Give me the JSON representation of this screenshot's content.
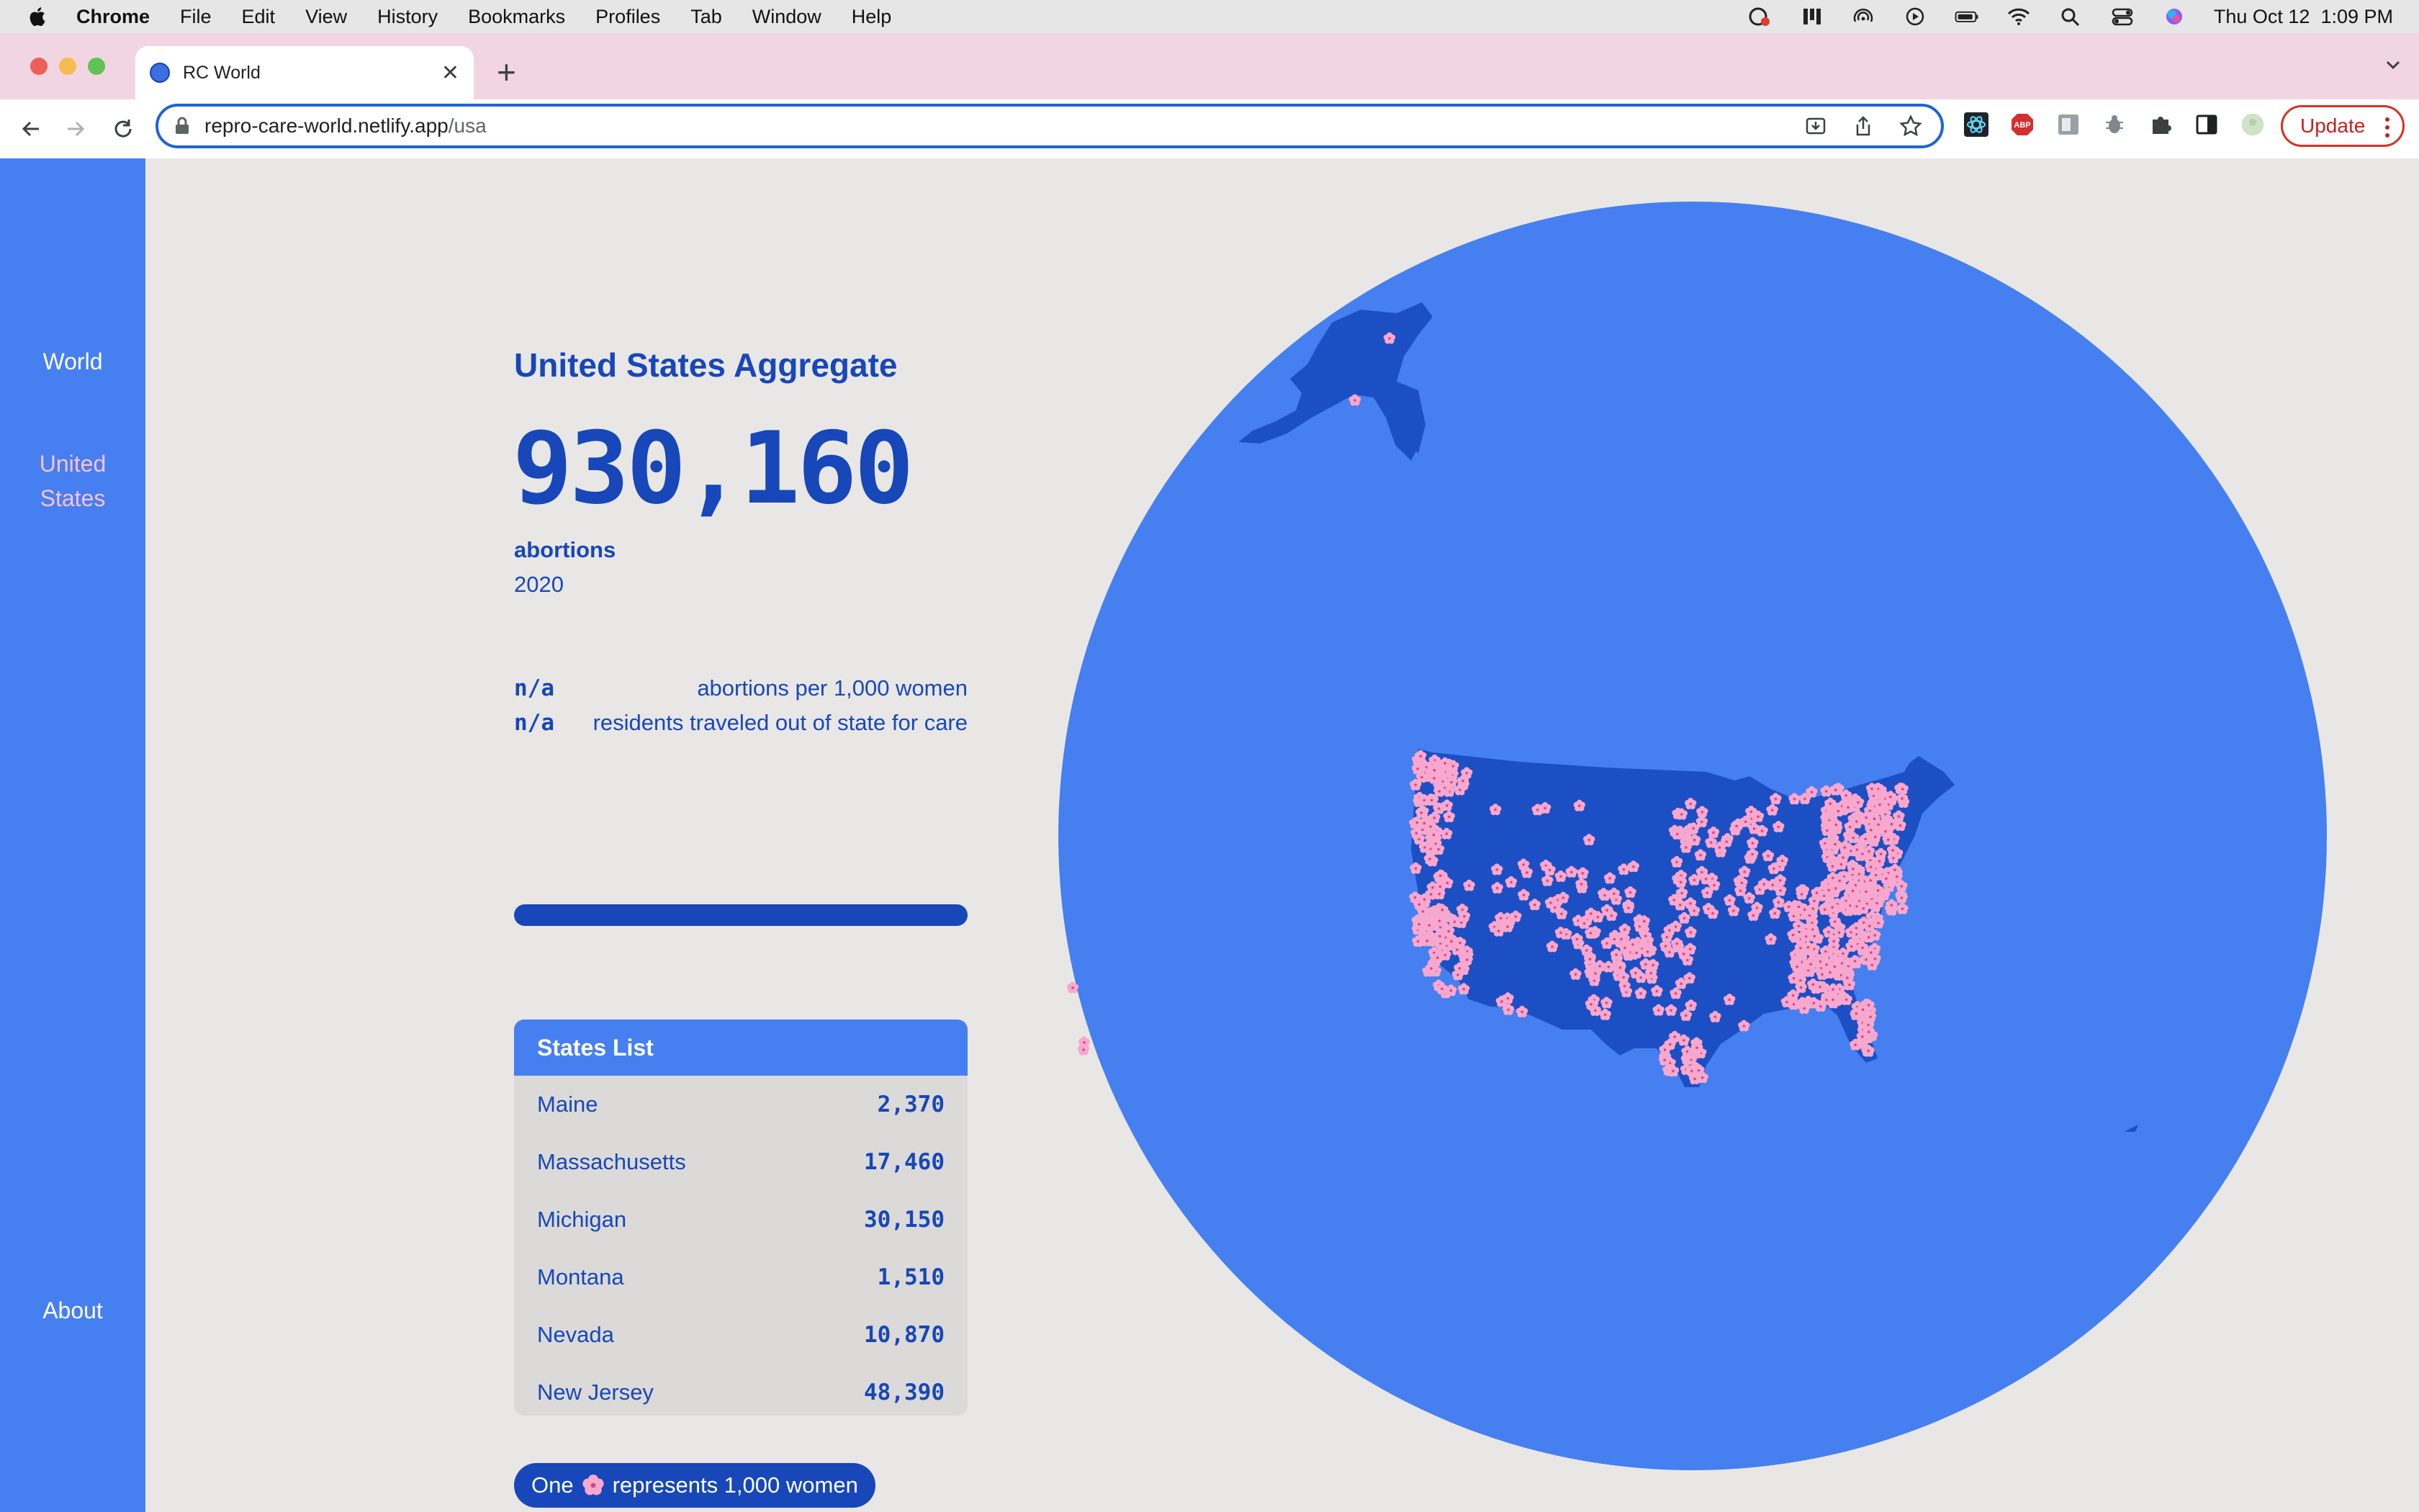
{
  "menubar": {
    "app_name": "Chrome",
    "items": [
      "File",
      "Edit",
      "View",
      "History",
      "Bookmarks",
      "Profiles",
      "Tab",
      "Window",
      "Help"
    ],
    "clock": "Thu Oct 12  1:09 PM"
  },
  "browser": {
    "tab_title": "RC World",
    "url_host": "repro-care-world.netlify.app",
    "url_path": "/usa",
    "update_label": "Update"
  },
  "sidebar": {
    "world": "World",
    "united_states_line1": "United",
    "united_states_line2": "States",
    "about": "About"
  },
  "summary": {
    "title": "United States Aggregate",
    "total": "930,160",
    "metric": "abortions",
    "year": "2020",
    "rate_value": "n/a",
    "rate_label": "abortions per 1,000 women",
    "travel_value": "n/a",
    "travel_label": "residents traveled out of state for care"
  },
  "states_list": {
    "header": "States List",
    "rows": [
      {
        "name": "Maine",
        "value": "2,370"
      },
      {
        "name": "Massachusetts",
        "value": "17,460"
      },
      {
        "name": "Michigan",
        "value": "30,150"
      },
      {
        "name": "Montana",
        "value": "1,510"
      },
      {
        "name": "Nevada",
        "value": "10,870"
      },
      {
        "name": "New Jersey",
        "value": "48,390"
      }
    ]
  },
  "legend": {
    "prefix": "One",
    "suffix": "represents 1,000 women"
  },
  "colors": {
    "sidebar": "#467ff0",
    "text_accent": "#1747b8",
    "globe": "#467ff0",
    "land": "#1d4fc4",
    "flower": "#f7a8cf"
  }
}
